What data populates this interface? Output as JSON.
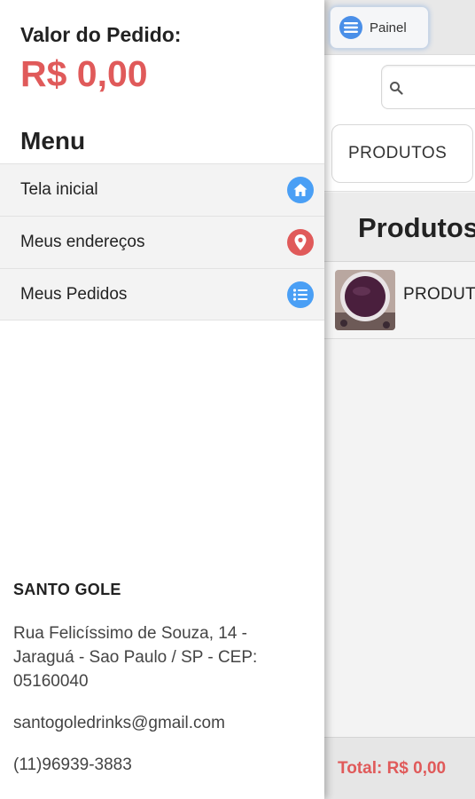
{
  "panel": {
    "order_label": "Valor do Pedido:",
    "order_value": "R$ 0,00",
    "menu_title": "Menu",
    "menu_items": [
      {
        "label": "Tela inicial",
        "icon": "home-icon",
        "color": "#4a9ff5"
      },
      {
        "label": "Meus endereços",
        "icon": "map-pin-icon",
        "color": "#e05a5a"
      },
      {
        "label": "Meus Pedidos",
        "icon": "list-icon",
        "color": "#4a9ff5"
      }
    ],
    "store": {
      "name": "SANTO GOLE",
      "address_line1": "Rua Felicíssimo de Souza, 14 -",
      "address_line2": "Jaraguá - Sao Paulo / SP - CEP:",
      "address_line3": "05160040",
      "email": "santogoledrinks@gmail.com",
      "phone": "(11)96939-3883"
    }
  },
  "header": {
    "painel_label": "Painel"
  },
  "main": {
    "tab_label": "PRODUTOS",
    "section_title": "Produtos",
    "product_name": "PRODUTO",
    "total": "Total: R$ 0,00"
  },
  "colors": {
    "accent_red": "#e05a5a",
    "accent_blue": "#4a9ff5"
  }
}
